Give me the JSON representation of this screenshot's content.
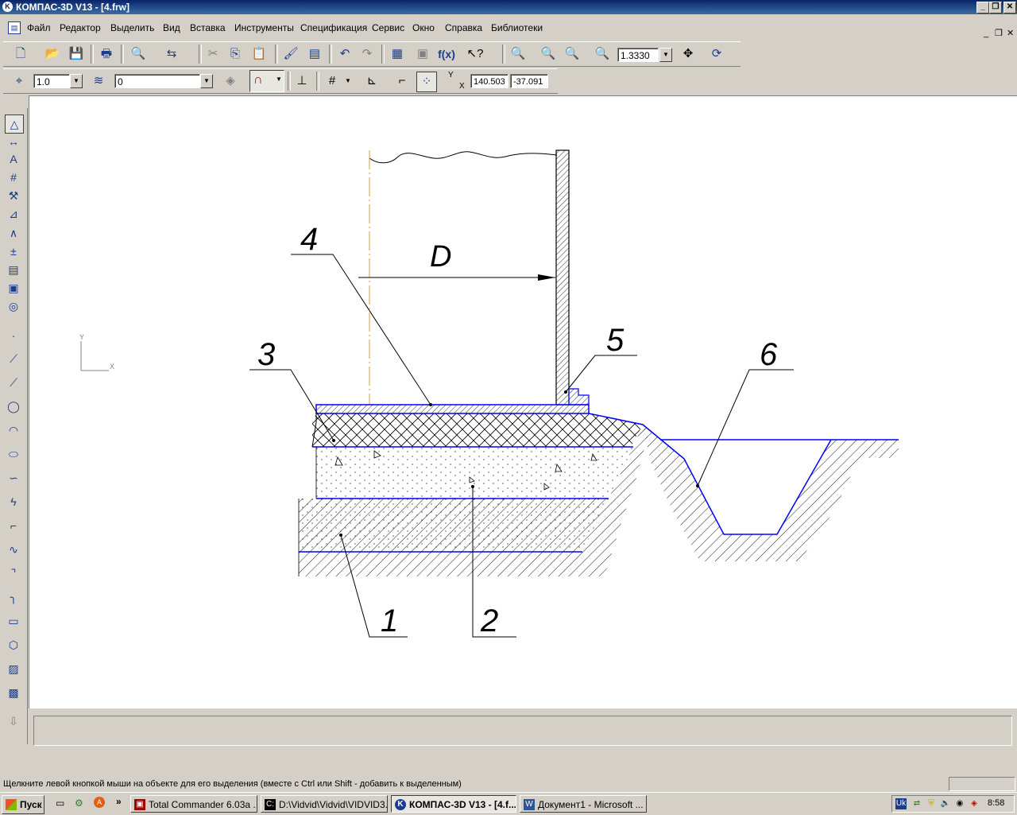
{
  "window": {
    "title": "КОМПАС-3D V13 - [4.frw]",
    "title_icon": "kompas-logo-icon",
    "minimize": "_",
    "restore": "❐",
    "close": "✕"
  },
  "menu": {
    "items": [
      "Файл",
      "Редактор",
      "Выделить",
      "Вид",
      "Вставка",
      "Инструменты",
      "Спецификация",
      "Сервис",
      "Окно",
      "Справка",
      "Библиотеки"
    ],
    "doc_minimize": "_",
    "doc_restore": "❐",
    "doc_close": "✕"
  },
  "standard_toolbar": {
    "zoom_value": "1.3330",
    "formula_label": "f(x)"
  },
  "current_state_toolbar": {
    "step_value": "1.0",
    "layer_value": "0",
    "coord_y_label": "Y",
    "coord_x_label": "X",
    "coord_x": "140.503",
    "coord_y": "-37.091"
  },
  "drawing": {
    "axis_y": "Y",
    "axis_x": "X",
    "dimension_label": "D",
    "callouts": [
      "1",
      "2",
      "3",
      "4",
      "5",
      "6"
    ],
    "line_color": "#0000ff",
    "axis_color": "#c8a040"
  },
  "status": {
    "hint": "Щелкните левой кнопкой мыши на объекте для его выделения (вместе с Ctrl или Shift - добавить к выделенным)"
  },
  "taskbar": {
    "start_label": "Пуск",
    "more_label": "»",
    "tasks": [
      {
        "label": "Total Commander 6.03a ...",
        "active": false
      },
      {
        "label": "D:\\Vidvid\\Vidvid\\VIDVID3...",
        "active": false
      },
      {
        "label": "КОМПАС-3D V13 - [4.f...",
        "active": true
      },
      {
        "label": "Документ1 - Microsoft ...",
        "active": false
      }
    ],
    "lang": "Uk",
    "clock": "8:58"
  }
}
